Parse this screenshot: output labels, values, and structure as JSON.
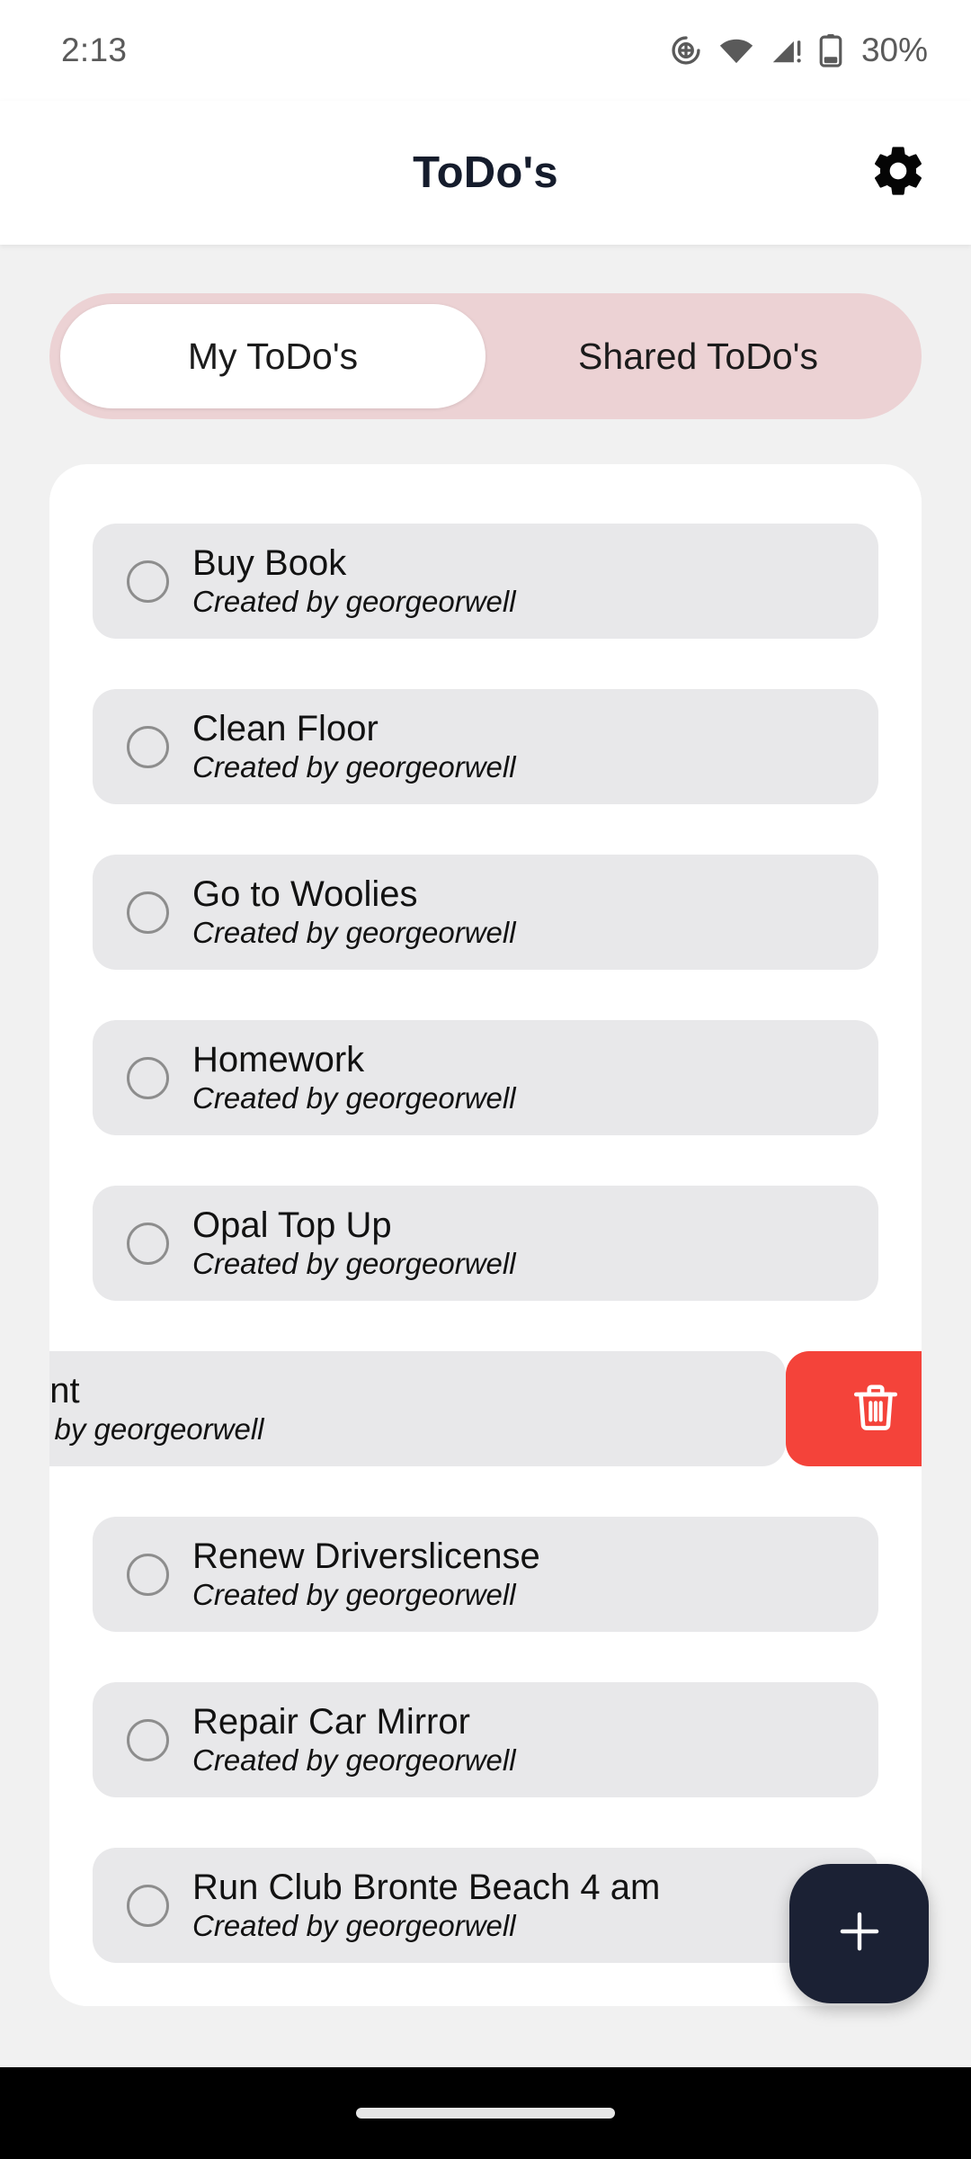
{
  "status_bar": {
    "time": "2:13",
    "battery_percent": "30%",
    "icons": [
      "location-crosshair-icon",
      "wifi-icon",
      "cellular-signal-warning-icon",
      "battery-icon"
    ]
  },
  "app_bar": {
    "title": "ToDo's",
    "settings_icon": "gear-icon"
  },
  "tabs": [
    {
      "label": "My ToDo's",
      "active": true
    },
    {
      "label": "Shared ToDo's",
      "active": false
    }
  ],
  "todos": [
    {
      "title": "Buy Book",
      "subtitle": "Created by georgeorwell",
      "checked": false,
      "swiped": false
    },
    {
      "title": "Clean Floor",
      "subtitle": "Created by georgeorwell",
      "checked": false,
      "swiped": false
    },
    {
      "title": "Go to Woolies",
      "subtitle": "Created by georgeorwell",
      "checked": false,
      "swiped": false
    },
    {
      "title": "Homework",
      "subtitle": "Created by georgeorwell",
      "checked": false,
      "swiped": false
    },
    {
      "title": "Opal Top Up",
      "subtitle": "Created by georgeorwell",
      "checked": false,
      "swiped": false
    },
    {
      "title": "ent",
      "subtitle": "d by georgeorwell",
      "checked": false,
      "swiped": true,
      "delete_icon": "trash-icon"
    },
    {
      "title": "Renew Driverslicense",
      "subtitle": "Created by georgeorwell",
      "checked": false,
      "swiped": false
    },
    {
      "title": "Repair Car Mirror",
      "subtitle": "Created by georgeorwell",
      "checked": false,
      "swiped": false
    },
    {
      "title": "Run Club Bronte Beach 4 am",
      "subtitle": "Created by georgeorwell",
      "checked": false,
      "swiped": false
    }
  ],
  "fab": {
    "icon": "plus-icon",
    "label": "+"
  },
  "nav_bar": {
    "gesture_pill": "home-indicator"
  },
  "colors": {
    "page_background": "#f1f1f1",
    "card_background": "#ffffff",
    "tab_track": "#ecd2d4",
    "tab_active": "#ffffff",
    "row_background": "#e8e8ea",
    "delete_red": "#f4433a",
    "fab_navy": "#1b2134",
    "title_text": "#151c2c",
    "status_text": "#5a5a5a"
  }
}
